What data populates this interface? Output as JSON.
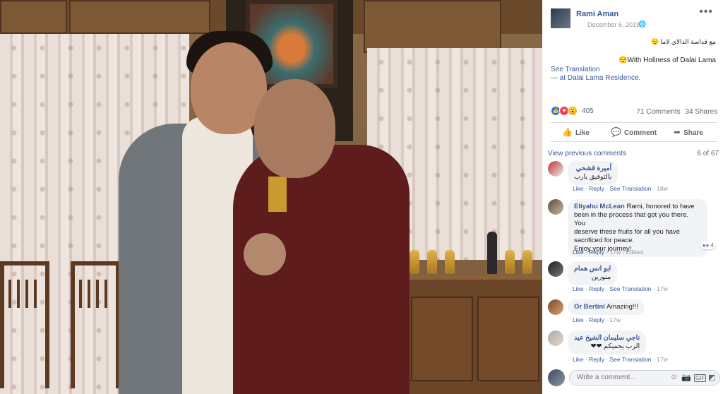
{
  "post": {
    "author": "Rami Aman",
    "date": "December 6, 2019",
    "globe_icon": "globe-icon",
    "more_label": "•••",
    "text_arabic": "مع قداسة الدالاي لاما 😌",
    "text_english": "😌With Holiness of Dalai Lama",
    "see_translation": "See Translation",
    "at_prefix": "— at ",
    "location": "Dalai Lama Residence",
    "location_suffix": "."
  },
  "reactions": {
    "count": "405",
    "comments": "71 Comments",
    "shares": "34 Shares",
    "icons": [
      "like-icon",
      "love-icon",
      "wow-icon"
    ],
    "colors": {
      "like": "#1877f2",
      "love": "#f33e58",
      "wow": "#f7b125"
    }
  },
  "actions": {
    "like": "Like",
    "comment": "Comment",
    "share": "Share"
  },
  "comments_header": {
    "view_previous": "View previous comments",
    "page_count": "6 of 67"
  },
  "comments": [
    {
      "name": "أميرة قشحي",
      "text": "بالتوفيق يارب",
      "like": "Like",
      "reply": "Reply",
      "see_translation": "See Translation",
      "time": "18w"
    },
    {
      "name": "Eliyahu McLean",
      "text1": "Rami, honored to have",
      "text2": "been in the process that got you there. You",
      "text3": "deserve these fruits for all you have",
      "text4": "sacrificed for peace.",
      "text5": "Enjoy your journey!",
      "like": "Like",
      "reply": "Reply",
      "time": "17w",
      "edited": "Edited",
      "react_count": "4"
    },
    {
      "name": "ابو انس همام",
      "text": "منورين",
      "like": "Like",
      "reply": "Reply",
      "see_translation": "See Translation",
      "time": "17w"
    },
    {
      "name": "Or Bertini",
      "text": "Amazing!!!",
      "like": "Like",
      "reply": "Reply",
      "time": "17w"
    },
    {
      "name": "ناجي سليمان الشيخ عيد",
      "text": "الرب يحميكم ❤❤",
      "like": "Like",
      "reply": "Reply",
      "see_translation": "See Translation",
      "time": "17w"
    }
  ],
  "composer": {
    "placeholder": "Write a comment...",
    "icons": [
      "emoji-icon",
      "camera-icon",
      "gif-icon",
      "sticker-icon"
    ]
  }
}
